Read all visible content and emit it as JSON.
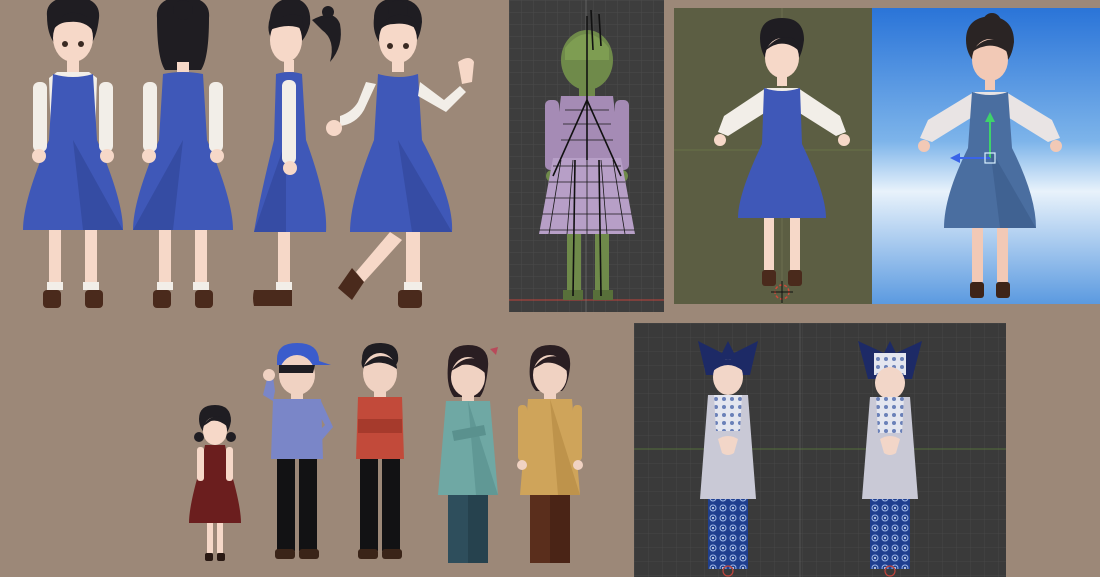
{
  "scene": {
    "description_free": true,
    "colors": {
      "backdrop": "#9c8878",
      "dress_blue": "#3f58b8",
      "dress_blue_shadow": "#2f4494",
      "shirt_white": "#f2eee8",
      "skin": "#f6d8c8",
      "hair": "#1f1d22",
      "shoe": "#4a2a1c",
      "viewport_grey": "#3d3d3d",
      "olive_render_bg": "#5c5e43",
      "sky_top": "#2a74d8",
      "sky_bottom": "#e8f2fb",
      "rig_mesh_purple": "#a58bb5",
      "rig_mesh_green": "#6f8a4a",
      "kebaya_top": "#c9c9d6",
      "batik_blue": "#1f3f8f",
      "headdress_navy": "#1d2a66"
    },
    "panels": [
      {
        "name": "turnaround-sheet",
        "views": [
          "front",
          "back",
          "side",
          "walk"
        ]
      },
      {
        "name": "rig-viewport"
      },
      {
        "name": "t-pose-render-olive"
      },
      {
        "name": "t-pose-render-sky"
      },
      {
        "name": "character-lineup",
        "characters": [
          "girl-red-dress",
          "boy-cap-blue",
          "boy-red-shirt",
          "woman-teal-kebaya",
          "woman-gold-kebaya"
        ]
      },
      {
        "name": "costume-viewport",
        "characters": [
          "kebaya-front",
          "kebaya-back"
        ]
      }
    ]
  }
}
